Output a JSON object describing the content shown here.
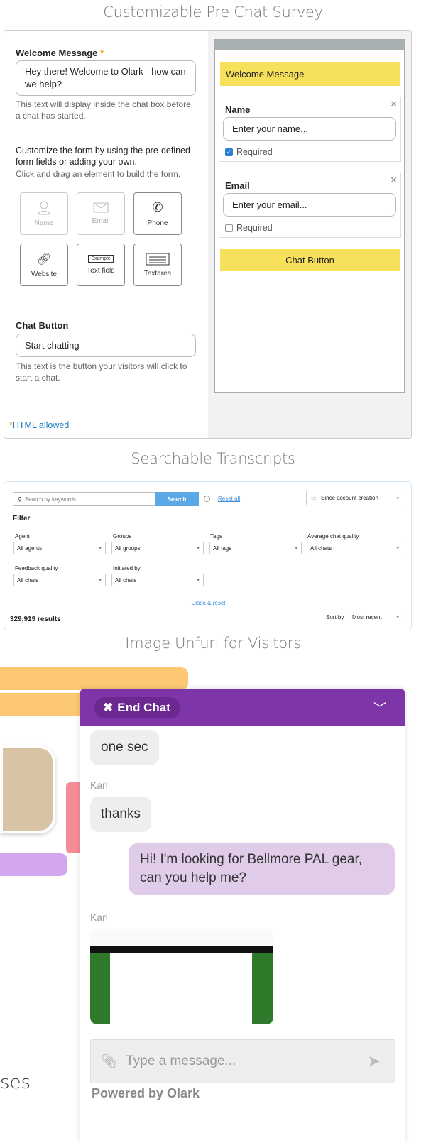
{
  "sections": {
    "survey": "Customizable Pre Chat Survey",
    "transcripts": "Searchable Transcripts",
    "unfurl": "Image Unfurl for Visitors"
  },
  "survey": {
    "welcome_label": "Welcome Message",
    "required_star": "*",
    "welcome_value": "Hey there! Welcome to Olark - how can we help?",
    "welcome_help": "This text will display inside the chat box before a chat has started.",
    "customize_text": "Customize the form by using the pre-defined form fields or adding your own.",
    "drag_help": "Click and drag an element to build the form.",
    "tiles": [
      {
        "label": "Name",
        "icon": "person-icon",
        "active": false
      },
      {
        "label": "Email",
        "icon": "envelope-icon",
        "active": false
      },
      {
        "label": "Phone",
        "icon": "phone-icon",
        "active": true
      },
      {
        "label": "Website",
        "icon": "link-icon",
        "active": true
      },
      {
        "label": "Text field",
        "icon": "text-field-icon",
        "active": true,
        "badge": "Example"
      },
      {
        "label": "Textarea",
        "icon": "textarea-icon",
        "active": true
      }
    ],
    "chat_button_label": "Chat Button",
    "chat_button_value": "Start chatting",
    "chat_button_help": "This text is the button your visitors will click to start a chat.",
    "html_allowed": "HTML allowed",
    "preview": {
      "welcome": "Welcome Message",
      "name_label": "Name",
      "name_placeholder": "Enter your name...",
      "name_required": "Required",
      "name_required_checked": true,
      "email_label": "Email",
      "email_placeholder": "Enter your email...",
      "email_required": "Required",
      "email_required_checked": false,
      "button": "Chat Button",
      "close": "✕"
    },
    "colors": {
      "yellow": "#f7e05a",
      "accent": "#f5a623",
      "link": "#1a7bbf"
    }
  },
  "transcripts": {
    "search_placeholder": "Search by keywords",
    "search_button": "Search",
    "reset_all": "Reset all",
    "date_range": "Since account creation",
    "filter_title": "Filter",
    "filters": [
      {
        "label": "Agent",
        "value": "All agents"
      },
      {
        "label": "Groups",
        "value": "All groups"
      },
      {
        "label": "Tags",
        "value": "All tags"
      },
      {
        "label": "Average chat quality",
        "value": "All chats"
      },
      {
        "label": "Feedback quality",
        "value": "All chats"
      },
      {
        "label": "Initiated by",
        "value": "All chats"
      }
    ],
    "close_reset": "Close & reset",
    "results": "329,919 results",
    "sort_label": "Sort by",
    "sort_value": "Most recent",
    "colors": {
      "search_button": "#5aa9e6"
    }
  },
  "chat": {
    "end_chat": "End Chat",
    "messages": [
      {
        "from": "agent",
        "text": "one sec"
      },
      {
        "from": "agent",
        "name": "Karl",
        "text": "thanks"
      },
      {
        "from": "visitor",
        "text": "Hi! I'm looking for Bellmore PAL gear, can you help me?"
      },
      {
        "from": "agent",
        "name": "Karl",
        "image": "website screenshot"
      }
    ],
    "input_placeholder": "Type a message...",
    "powered_by": "Powered by Olark",
    "bg_partial_text": "ses",
    "colors": {
      "header": "#7d35a8",
      "visitor_bubble": "#e0cce9",
      "agent_bubble": "#eeeeee"
    }
  }
}
